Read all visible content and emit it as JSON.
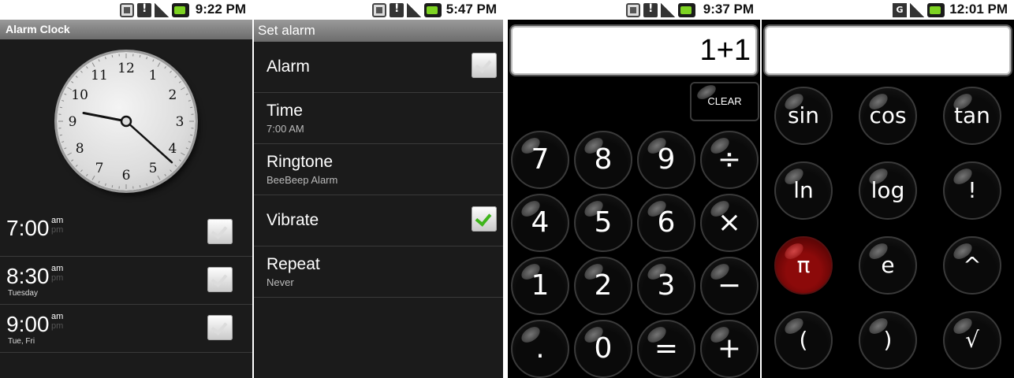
{
  "alarm_clock": {
    "status_time": "9:22 PM",
    "title": "Alarm Clock",
    "clock_numbers": [
      "12",
      "1",
      "2",
      "3",
      "4",
      "5",
      "6",
      "7",
      "8",
      "9",
      "10",
      "11"
    ],
    "alarms": [
      {
        "time": "7:00",
        "am": "am",
        "pm": "pm",
        "days": "",
        "enabled": false
      },
      {
        "time": "8:30",
        "am": "am",
        "pm": "pm",
        "days": "Tuesday",
        "enabled": false
      },
      {
        "time": "9:00",
        "am": "am",
        "pm": "pm",
        "days": "Tue, Fri",
        "enabled": false
      }
    ]
  },
  "set_alarm": {
    "status_time": "5:47 PM",
    "title": "Set alarm",
    "items": [
      {
        "title": "Alarm",
        "subtitle": "",
        "checkbox": true,
        "checked": false
      },
      {
        "title": "Time",
        "subtitle": "7:00 AM",
        "checkbox": false
      },
      {
        "title": "Ringtone",
        "subtitle": "BeeBeep Alarm",
        "checkbox": false
      },
      {
        "title": "Vibrate",
        "subtitle": "",
        "checkbox": true,
        "checked": true
      },
      {
        "title": "Repeat",
        "subtitle": "Never",
        "checkbox": false
      }
    ]
  },
  "calculator_basic": {
    "status_time": "9:37 PM",
    "display": "1+1",
    "clear_label": "CLEAR",
    "keys": [
      "7",
      "8",
      "9",
      "÷",
      "4",
      "5",
      "6",
      "×",
      "1",
      "2",
      "3",
      "−",
      ".",
      "0",
      "=",
      "+"
    ]
  },
  "calculator_advanced": {
    "status_time": "12:01 PM",
    "display": "",
    "keys": [
      "sin",
      "cos",
      "tan",
      "ln",
      "log",
      "!",
      "π",
      "e",
      "^",
      "(",
      ")",
      "√"
    ]
  }
}
